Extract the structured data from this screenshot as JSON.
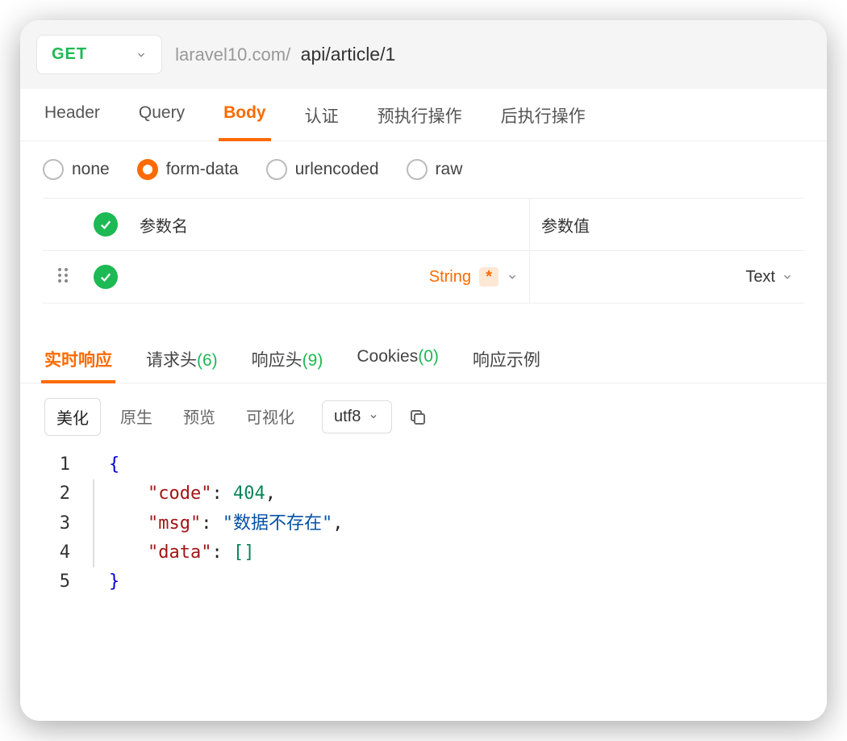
{
  "request": {
    "method": "GET",
    "host": "laravel10.com/",
    "path": "api/article/1"
  },
  "main_tabs": [
    {
      "label": "Header",
      "active": false
    },
    {
      "label": "Query",
      "active": false
    },
    {
      "label": "Body",
      "active": true
    },
    {
      "label": "认证",
      "active": false
    },
    {
      "label": "预执行操作",
      "active": false
    },
    {
      "label": "后执行操作",
      "active": false
    }
  ],
  "body_types": [
    {
      "label": "none",
      "selected": false
    },
    {
      "label": "form-data",
      "selected": true
    },
    {
      "label": "urlencoded",
      "selected": false
    },
    {
      "label": "raw",
      "selected": false
    }
  ],
  "params_header": {
    "name_label": "参数名",
    "value_label": "参数值"
  },
  "params_row": {
    "type_label": "String",
    "required_mark": "*",
    "value_type": "Text"
  },
  "response_tabs": [
    {
      "label": "实时响应",
      "count": "",
      "active": true
    },
    {
      "label": "请求头",
      "count": "(6)",
      "active": false
    },
    {
      "label": "响应头",
      "count": "(9)",
      "active": false
    },
    {
      "label": "Cookies",
      "count": "(0)",
      "active": false
    },
    {
      "label": "响应示例",
      "count": "",
      "active": false
    }
  ],
  "view_modes": [
    {
      "label": "美化",
      "active": true
    },
    {
      "label": "原生",
      "active": false
    },
    {
      "label": "预览",
      "active": false
    },
    {
      "label": "可视化",
      "active": false
    }
  ],
  "encoding": "utf8",
  "response_body": {
    "lines": [
      {
        "n": "1",
        "tokens": [
          {
            "t": "{",
            "c": "brace"
          }
        ]
      },
      {
        "n": "2",
        "indent": 1,
        "tokens": [
          {
            "t": "\"code\"",
            "c": "key"
          },
          {
            "t": ":",
            "c": "colon"
          },
          {
            "t": " ",
            "c": ""
          },
          {
            "t": "404",
            "c": "num"
          },
          {
            "t": ",",
            "c": "punc"
          }
        ]
      },
      {
        "n": "3",
        "indent": 1,
        "tokens": [
          {
            "t": "\"msg\"",
            "c": "key"
          },
          {
            "t": ":",
            "c": "colon"
          },
          {
            "t": " ",
            "c": ""
          },
          {
            "t": "\"数据不存在\"",
            "c": "str"
          },
          {
            "t": ",",
            "c": "punc"
          }
        ]
      },
      {
        "n": "4",
        "indent": 1,
        "tokens": [
          {
            "t": "\"data\"",
            "c": "key"
          },
          {
            "t": ":",
            "c": "colon"
          },
          {
            "t": " ",
            "c": ""
          },
          {
            "t": "[]",
            "c": "num"
          }
        ]
      },
      {
        "n": "5",
        "tokens": [
          {
            "t": "}",
            "c": "brace"
          }
        ]
      }
    ]
  }
}
